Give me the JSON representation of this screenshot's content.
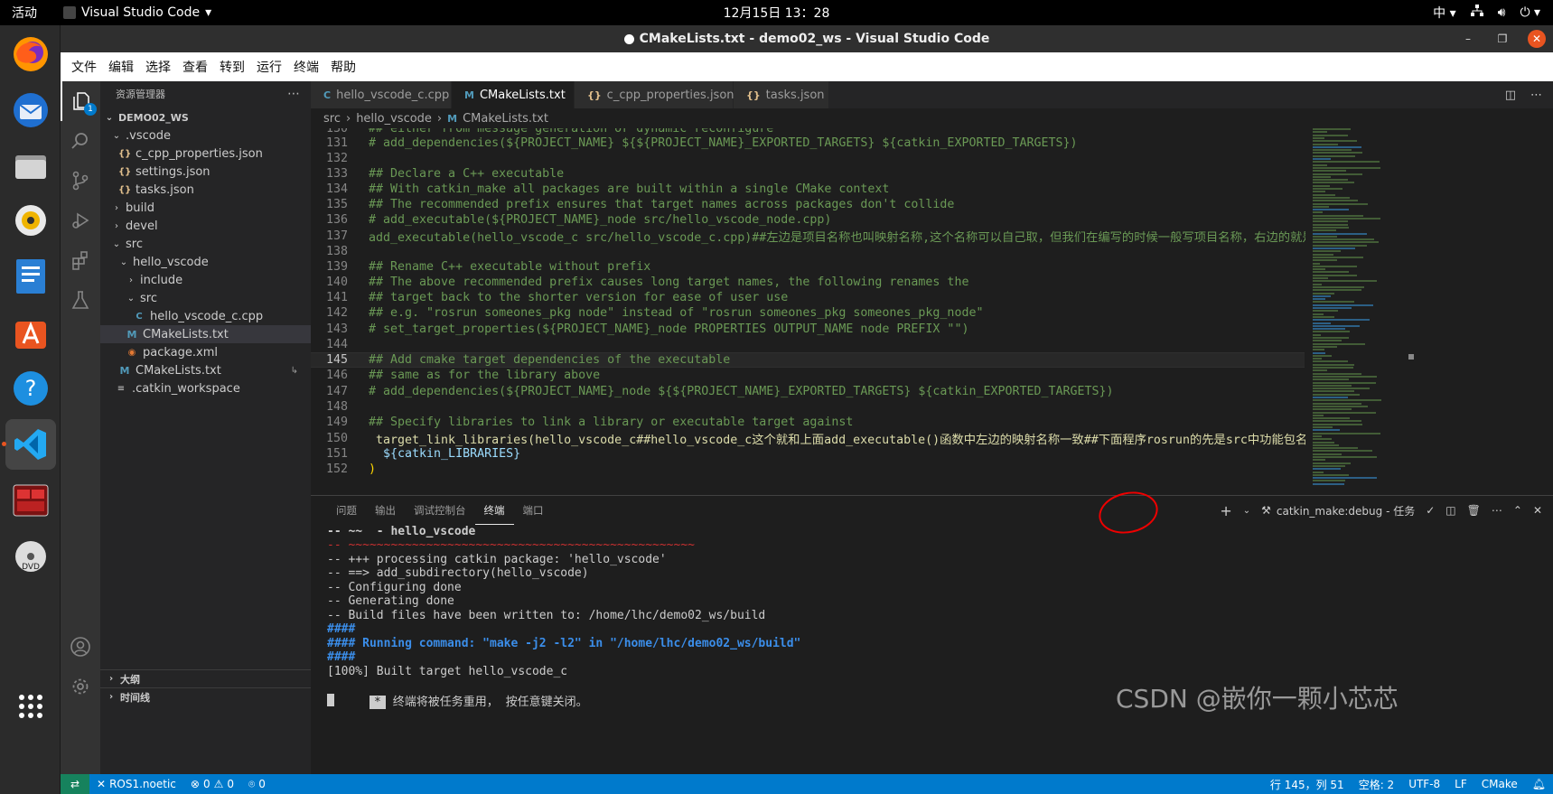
{
  "topbar": {
    "activities": "活动",
    "app_name": "Visual Studio Code",
    "clock": "12月15日 13：28",
    "input_method": "中"
  },
  "window": {
    "title": "CMakeLists.txt - demo02_ws - Visual Studio Code"
  },
  "menu": [
    "文件",
    "编辑",
    "选择",
    "查看",
    "转到",
    "运行",
    "终端",
    "帮助"
  ],
  "activity_bar": {
    "explorer_badge": "1"
  },
  "sidebar": {
    "header": "资源管理器",
    "workspace": "DEMO02_WS",
    "tree": [
      {
        "label": ".vscode",
        "type": "folder-open"
      },
      {
        "label": "c_cpp_properties.json",
        "type": "json"
      },
      {
        "label": "settings.json",
        "type": "json"
      },
      {
        "label": "tasks.json",
        "type": "json"
      },
      {
        "label": "build",
        "type": "folder"
      },
      {
        "label": "devel",
        "type": "folder"
      },
      {
        "label": "src",
        "type": "folder-open"
      },
      {
        "label": "hello_vscode",
        "type": "folder-open"
      },
      {
        "label": "include",
        "type": "folder"
      },
      {
        "label": "src",
        "type": "folder-open"
      },
      {
        "label": "hello_vscode_c.cpp",
        "type": "cpp"
      },
      {
        "label": "CMakeLists.txt",
        "type": "cmake"
      },
      {
        "label": "package.xml",
        "type": "xml"
      },
      {
        "label": "CMakeLists.txt",
        "type": "cmake"
      },
      {
        "label": ".catkin_workspace",
        "type": "ws"
      }
    ],
    "outline": "大纲",
    "timeline": "时间线"
  },
  "tabs": [
    {
      "label": "hello_vscode_c.cpp",
      "icon": "C"
    },
    {
      "label": "CMakeLists.txt",
      "icon": "M"
    },
    {
      "label": "c_cpp_properties.json",
      "icon": "{}"
    },
    {
      "label": "tasks.json",
      "icon": "{}"
    }
  ],
  "breadcrumb": [
    "src",
    "hello_vscode",
    "CMakeLists.txt"
  ],
  "editor": {
    "lines": [
      {
        "n": "130",
        "t": "## either from message generation or dynamic reconfigure"
      },
      {
        "n": "131",
        "t": "# add_dependencies(${PROJECT_NAME} ${${PROJECT_NAME}_EXPORTED_TARGETS} ${catkin_EXPORTED_TARGETS})"
      },
      {
        "n": "132",
        "t": ""
      },
      {
        "n": "133",
        "t": "## Declare a C++ executable"
      },
      {
        "n": "134",
        "t": "## With catkin_make all packages are built within a single CMake context"
      },
      {
        "n": "135",
        "t": "## The recommended prefix ensures that target names across packages don't collide"
      },
      {
        "n": "136",
        "t": "# add_executable(${PROJECT_NAME}_node src/hello_vscode_node.cpp)"
      },
      {
        "n": "137",
        "t": "add_executable(hello_vscode_c src/hello_vscode_c.cpp)##左边是项目名称也叫映射名称,这个名称可以自己取，但我们在编写的时候一般写项目名称，右边的就是.cpp"
      },
      {
        "n": "138",
        "t": ""
      },
      {
        "n": "139",
        "t": "## Rename C++ executable without prefix"
      },
      {
        "n": "140",
        "t": "## The above recommended prefix causes long target names, the following renames the"
      },
      {
        "n": "141",
        "t": "## target back to the shorter version for ease of user use"
      },
      {
        "n": "142",
        "t": "## e.g. \"rosrun someones_pkg node\" instead of \"rosrun someones_pkg someones_pkg_node\""
      },
      {
        "n": "143",
        "t": "# set_target_properties(${PROJECT_NAME}_node PROPERTIES OUTPUT_NAME node PREFIX \"\")"
      },
      {
        "n": "144",
        "t": ""
      },
      {
        "n": "145",
        "t": "## Add cmake target dependencies of the executable"
      },
      {
        "n": "146",
        "t": "## same as for the library above"
      },
      {
        "n": "147",
        "t": "# add_dependencies(${PROJECT_NAME}_node ${${PROJECT_NAME}_EXPORTED_TARGETS} ${catkin_EXPORTED_TARGETS})"
      },
      {
        "n": "148",
        "t": ""
      },
      {
        "n": "149",
        "t": "## Specify libraries to link a library or executable target against"
      },
      {
        "n": "150",
        "t": " target_link_libraries(hello_vscode_c##hello_vscode_c这个就和上面add_executable()函数中左边的映射名称一致##下面程序rosrun的先是src中功能包名称#hel"
      },
      {
        "n": "151",
        "t": "  ${catkin_LIBRARIES}"
      },
      {
        "n": "152",
        "t": ")"
      }
    ]
  },
  "panel": {
    "tabs": [
      "问题",
      "输出",
      "调试控制台",
      "终端",
      "端口"
    ],
    "task_label": "catkin_make:debug - 任务",
    "terminal": [
      "-- ~~  - hello_vscode",
      "-- ~~~~~~~~~~~~~~~~~~~~~~~~~~~~~~~~~~~~~~~~~~~~~~~~~",
      "-- +++ processing catkin package: 'hello_vscode'",
      "-- ==> add_subdirectory(hello_vscode)",
      "-- Configuring done",
      "-- Generating done",
      "-- Build files have been written to: /home/lhc/demo02_ws/build",
      "####",
      "#### Running command: \"make -j2 -l2\" in \"/home/lhc/demo02_ws/build\"",
      "####",
      "[100%] Built target hello_vscode_c",
      "终端将被任务重用， 按任意键关闭。"
    ]
  },
  "statusbar": {
    "ros": "ROS1.noetic",
    "errors": "0",
    "warnings": "0",
    "ports": "0",
    "position": "行 145，列 51",
    "spaces": "空格: 2",
    "encoding": "UTF-8",
    "eol": "LF",
    "language": "CMake"
  },
  "watermark": "CSDN @嵌你一颗小芯芯",
  "colors": {
    "accent": "#007acc",
    "ubuntu_orange": "#e95420",
    "annotation_red": "#e00000"
  }
}
